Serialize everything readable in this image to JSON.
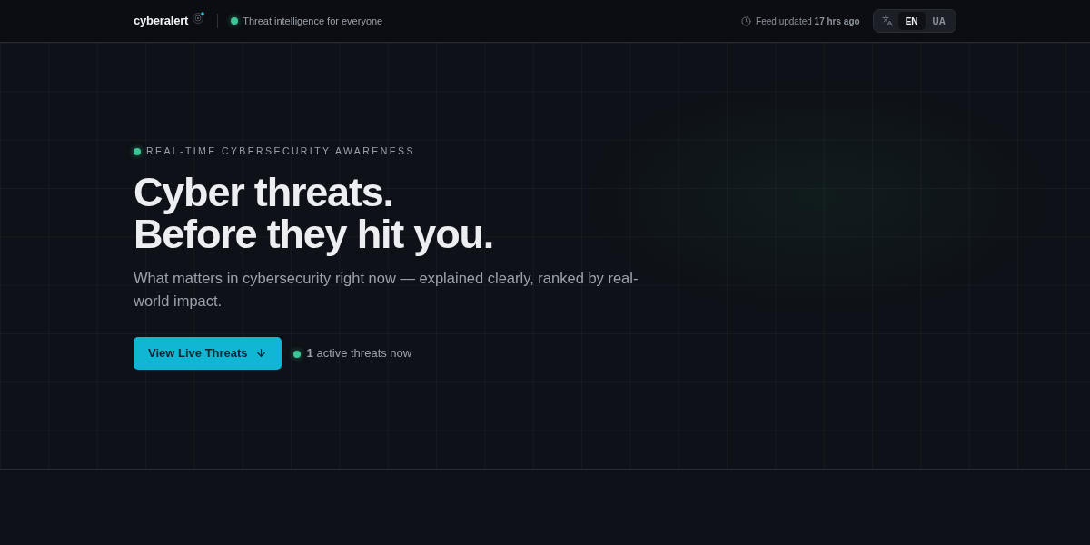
{
  "header": {
    "logo": "cyberalert",
    "tagline": "Threat intelligence for everyone",
    "feed_status": "Feed updated **17 hrs ago**",
    "languages": [
      {
        "label": "EN",
        "selected": true
      },
      {
        "label": "UA",
        "selected": false
      }
    ]
  },
  "hero": {
    "eyebrow": "REAL-TIME CYBERSECURITY AWARENESS",
    "title_lines": [
      "Cyber threats.",
      "Before they hit you."
    ],
    "subtitle": "What matters in cybersecurity right now — explained clearly, ranked by real-world impact.",
    "cta": "View Live Threats",
    "active_threats": "**1** active threats now"
  }
}
